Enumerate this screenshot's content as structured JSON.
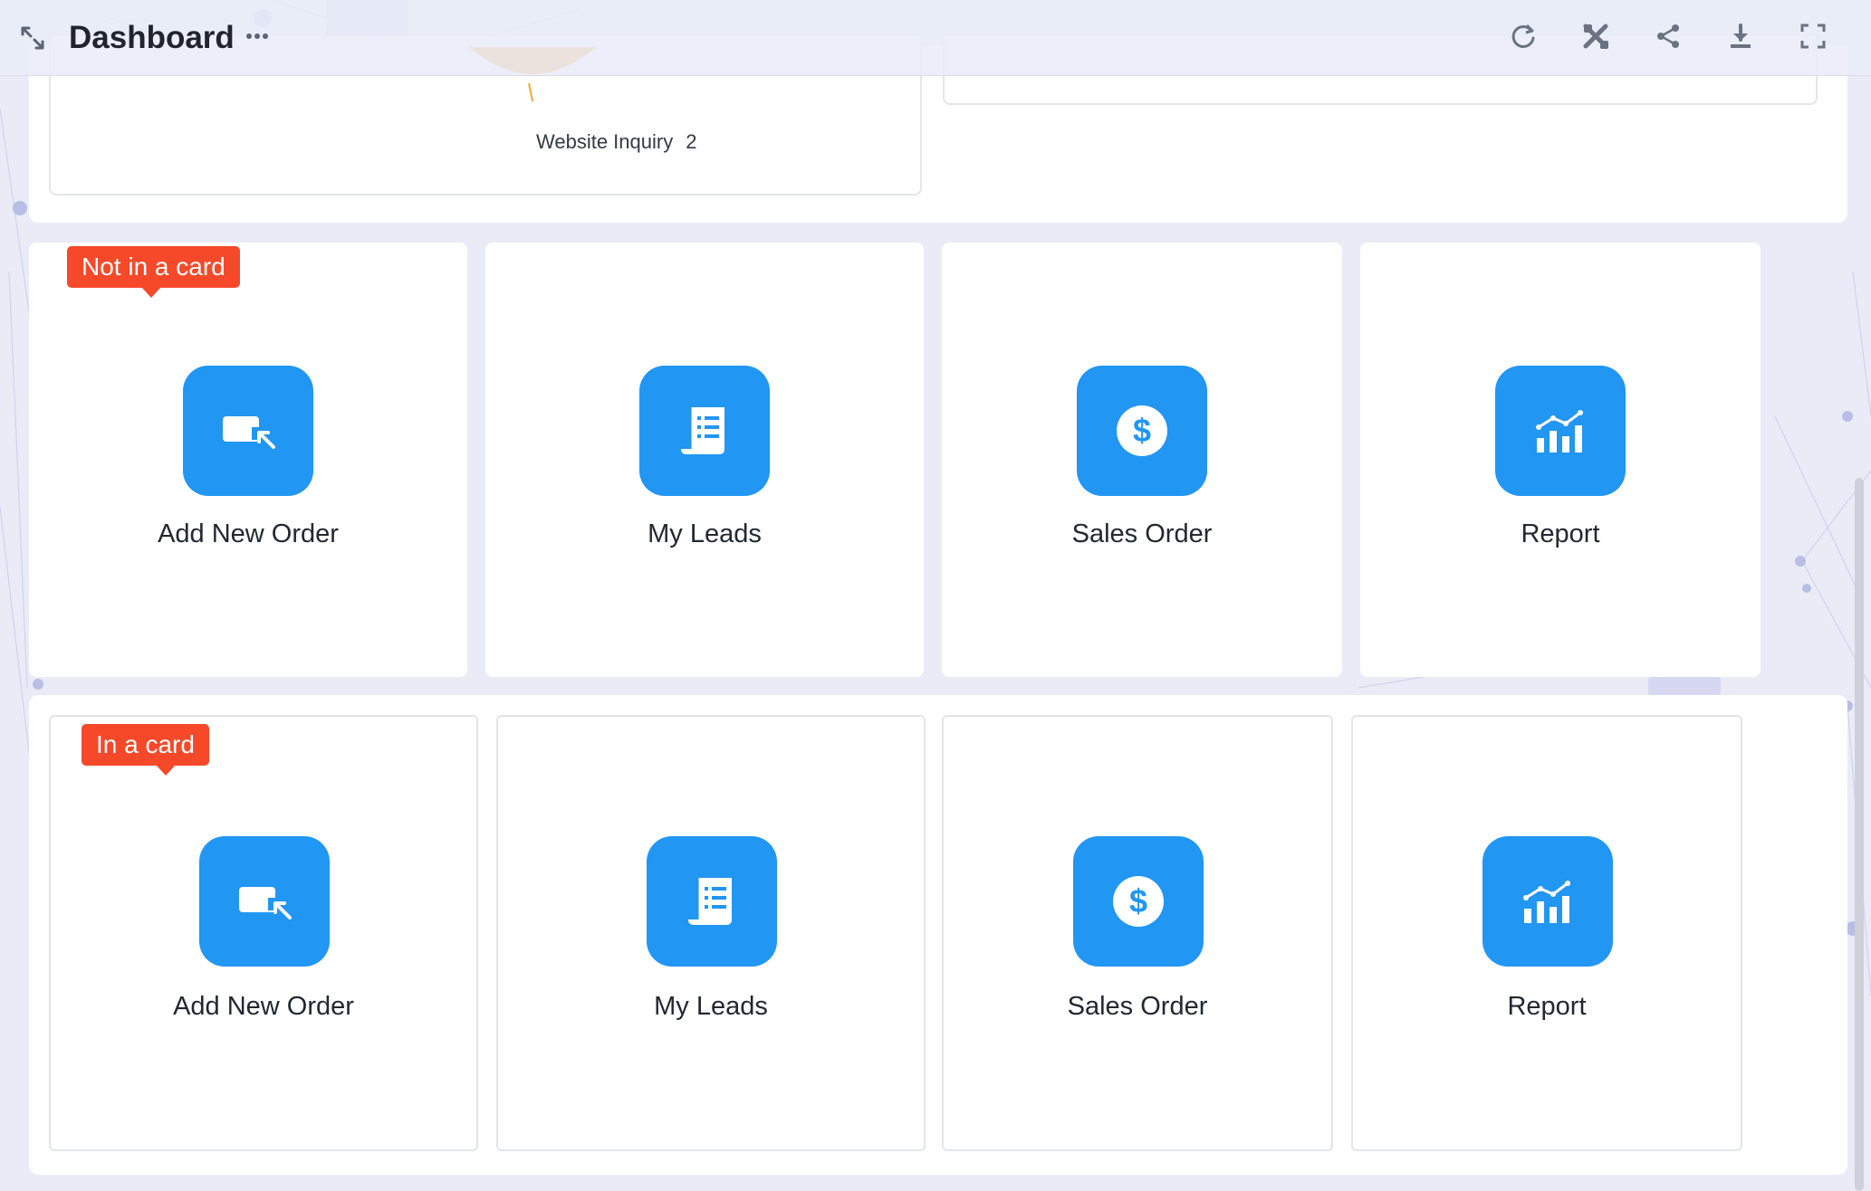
{
  "header": {
    "title": "Dashboard",
    "collapse_icon": "collapse-arrows-icon",
    "more_icon": "more-horizontal-icon",
    "actions": [
      {
        "name": "refresh-icon"
      },
      {
        "name": "tools-icon"
      },
      {
        "name": "share-icon"
      },
      {
        "name": "download-icon"
      },
      {
        "name": "fullscreen-icon"
      }
    ]
  },
  "chart": {
    "label": "Website Inquiry",
    "value": "2",
    "arc_color": "#f7a63a"
  },
  "sections": {
    "not_in_card": {
      "tag": "Not in a card",
      "tiles": [
        {
          "label": "Add New Order",
          "icon": "add-order-icon"
        },
        {
          "label": "My Leads",
          "icon": "leads-document-icon"
        },
        {
          "label": "Sales Order",
          "icon": "dollar-icon"
        },
        {
          "label": "Report",
          "icon": "chart-report-icon"
        }
      ]
    },
    "in_card": {
      "tag": "In a card",
      "tiles": [
        {
          "label": "Add New Order",
          "icon": "add-order-icon"
        },
        {
          "label": "My Leads",
          "icon": "leads-document-icon"
        },
        {
          "label": "Sales Order",
          "icon": "dollar-icon"
        },
        {
          "label": "Report",
          "icon": "chart-report-icon"
        }
      ]
    }
  },
  "colors": {
    "icon_bg": "#2196f3",
    "tag_bg": "#f5492a",
    "page_bg": "#e9ecf6"
  }
}
